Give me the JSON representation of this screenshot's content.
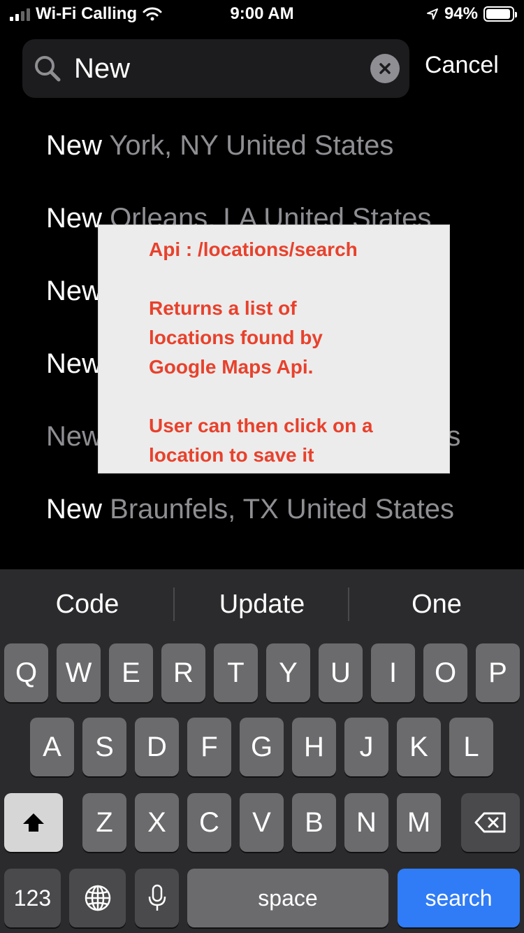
{
  "status_bar": {
    "carrier": "Wi-Fi Calling",
    "time": "9:00 AM",
    "battery": "94%",
    "battery_level": 0.94
  },
  "search": {
    "query": "New",
    "cancel_label": "Cancel"
  },
  "results": [
    {
      "match": "New",
      "rest": " York, NY United States"
    },
    {
      "match": "New",
      "rest": " Orleans, LA United States"
    },
    {
      "match": "New",
      "rest": ""
    },
    {
      "match": "New",
      "rest": ""
    },
    {
      "match": "New",
      "rest": "tes"
    },
    {
      "match": "New",
      "rest": " Braunfels, TX United States"
    }
  ],
  "note": {
    "line1": "Api : /locations/search",
    "line2": "Returns a list of",
    "line3": "locations found by",
    "line4": "Google Maps Api.",
    "line5": "User can then click on a",
    "line6": "location to save it"
  },
  "keyboard": {
    "predictions": [
      "Code",
      "Update",
      "One"
    ],
    "row1": [
      "Q",
      "W",
      "E",
      "R",
      "T",
      "Y",
      "U",
      "I",
      "O",
      "P"
    ],
    "row2": [
      "A",
      "S",
      "D",
      "F",
      "G",
      "H",
      "J",
      "K",
      "L"
    ],
    "row3": [
      "Z",
      "X",
      "C",
      "V",
      "B",
      "N",
      "M"
    ],
    "numbers_label": "123",
    "space_label": "space",
    "return_label": "search"
  }
}
